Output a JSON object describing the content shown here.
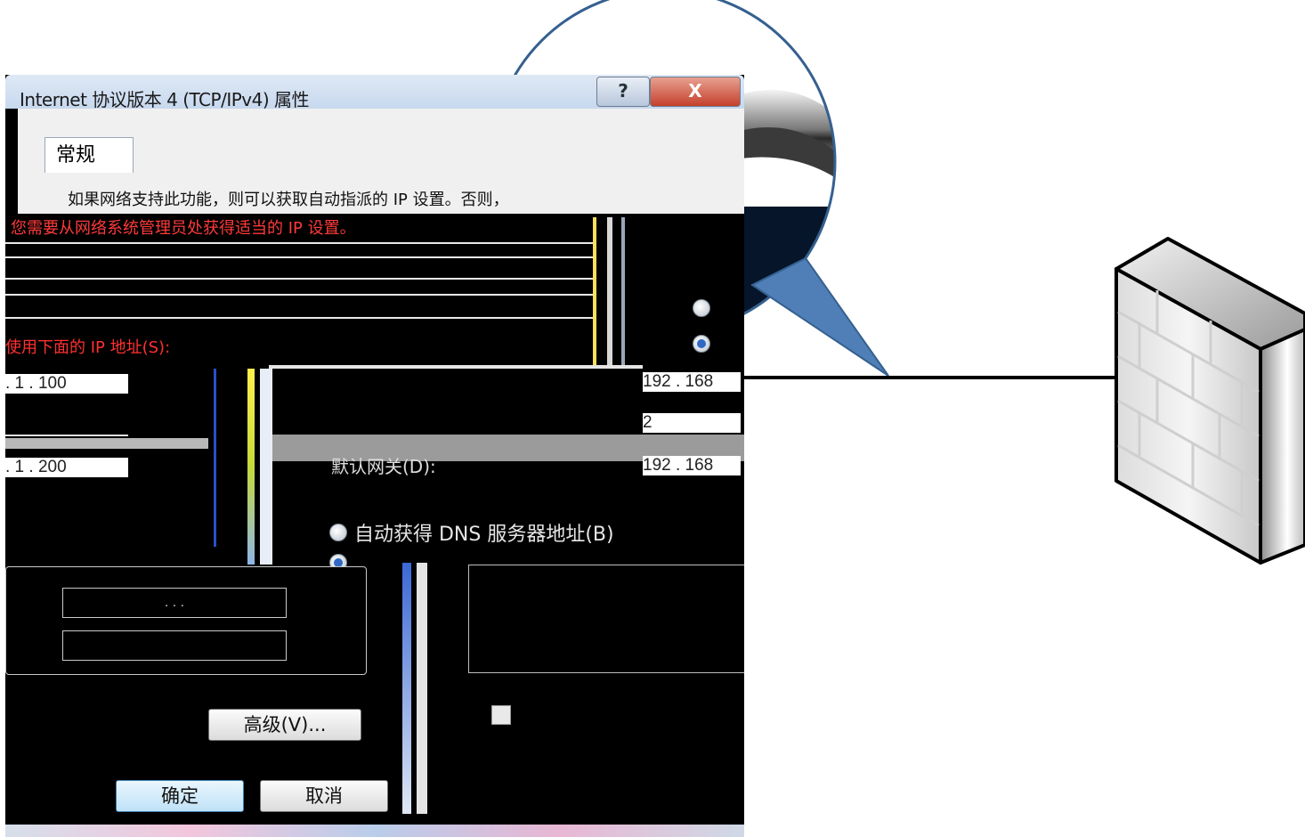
{
  "dialog": {
    "title": "Internet 协议版本 4 (TCP/IPv4) 属性",
    "help_label": "?",
    "close_label": "X",
    "tab_general": "常规",
    "description_line1": "如果网络支持此功能，则可以获取自动指派的 IP 设置。否则，",
    "description_line2": "您需要从网络系统管理员处获得适当的 IP 设置。",
    "use_following_ip_label": "使用下面的 IP 地址(S):",
    "ip_address_value": ". 1 . 100",
    "default_gateway_value": ". 1 . 200",
    "ip_right_1": "192 . 168",
    "ip_right_2": "2",
    "ip_right_3": "192 . 168",
    "gateway_label": "默认网关(D):",
    "auto_dns_label": "自动获得 DNS 服务器地址(B)",
    "advanced_button": "高级(V)...",
    "ok_button": "确定",
    "cancel_button": "取消",
    "dots_field": "  .   .   .  "
  }
}
